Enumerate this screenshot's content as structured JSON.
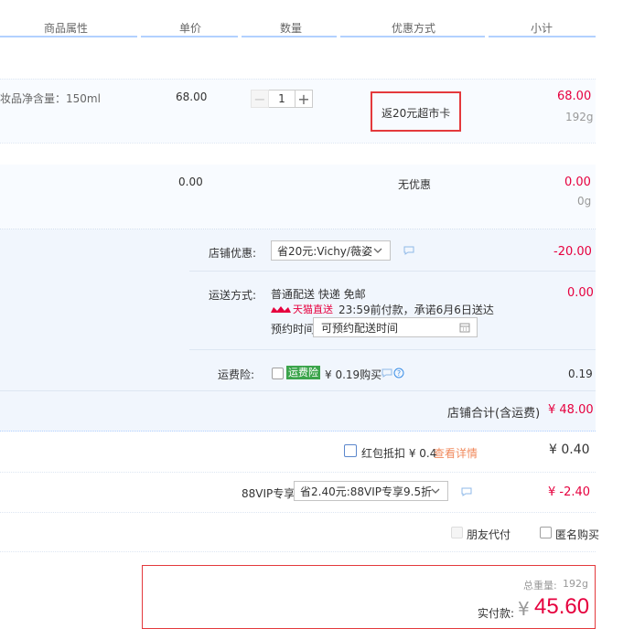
{
  "header": {
    "col_props": "商品属性",
    "col_price": "单价",
    "col_qty": "数量",
    "col_discount": "优惠方式",
    "col_subtotal": "小计"
  },
  "item1": {
    "props": "妆品净含量：150ml",
    "price": "68.00",
    "qty": "1",
    "discount": "返20元超市卡",
    "subtotal": "68.00",
    "weight": "192g"
  },
  "item2": {
    "price": "0.00",
    "discount": "无优惠",
    "subtotal": "0.00",
    "weight": "0g"
  },
  "shop": {
    "coupon_label": "店铺优惠:",
    "coupon_value": "省20元:Vichy/薇姿",
    "coupon_amount": "-20.00",
    "ship_label": "运送方式:",
    "ship_method": "普通配送 快递 免邮",
    "tmall_badge": "天猫直送",
    "ship_promise": "23:59前付款，承诺6月6日送达",
    "ship_fee": "0.00",
    "appoint_label": "预约时间",
    "appoint_value": "可预约配送时间",
    "insurance_label": "运费险:",
    "insurance_badge": "运费险",
    "insurance_price": "¥ 0.19购买",
    "insurance_amount": "0.19",
    "total_label": "店铺合计(含运费)",
    "total_amount": "¥ 48.00"
  },
  "redpacket": {
    "label": "红包抵扣 ¥ 0.4",
    "link": "查看详情",
    "amount": "¥ 0.40"
  },
  "vip": {
    "label": "88VIP专享",
    "select": "省2.40元:88VIP专享9.5折",
    "amount": "¥ -2.40"
  },
  "options": {
    "friend_pay": "朋友代付",
    "anonymous": "匿名购买"
  },
  "summary": {
    "weight_label": "总重量:",
    "weight_value": "192g",
    "pay_label": "实付款:",
    "currency": "¥",
    "pay_amount": "45.60"
  },
  "colors": {
    "accent_red": "#e4393c",
    "price_pink": "#e6003e",
    "band_blue": "#f1f6fd",
    "green_badge": "#3ba44b"
  }
}
